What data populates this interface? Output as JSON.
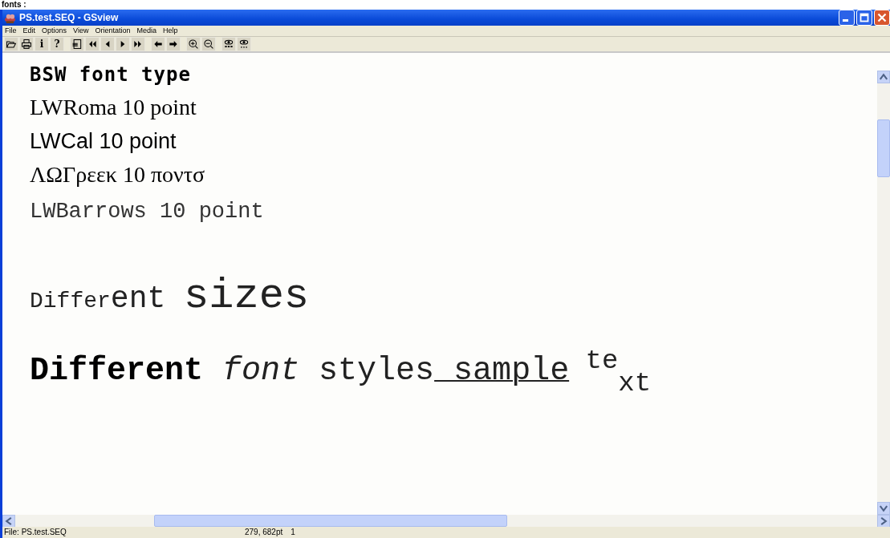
{
  "caption": "fonts :",
  "window": {
    "title": "PS.test.SEQ - GSview"
  },
  "menu": [
    "File",
    "Edit",
    "Options",
    "View",
    "Orientation",
    "Media",
    "Help"
  ],
  "toolbar": [
    [
      {
        "kind": "open"
      },
      {
        "kind": "print"
      },
      {
        "kind": "text",
        "label": "i"
      },
      {
        "kind": "text",
        "label": "?"
      }
    ],
    [
      {
        "kind": "page"
      },
      {
        "kind": "first"
      },
      {
        "kind": "prev"
      },
      {
        "kind": "next"
      },
      {
        "kind": "last"
      }
    ],
    [
      {
        "kind": "back"
      },
      {
        "kind": "forward"
      }
    ],
    [
      {
        "kind": "zoomin"
      },
      {
        "kind": "zoomout"
      }
    ],
    [
      {
        "kind": "eyeabc"
      },
      {
        "kind": "eyedots"
      }
    ]
  ],
  "document": {
    "lines": [
      {
        "kind": "pixel",
        "segments": [
          {
            "kind": "plain",
            "text": "BSW font type"
          }
        ]
      },
      {
        "kind": "serif",
        "segments": [
          {
            "kind": "plain",
            "text": "LWRoma 10 point"
          }
        ]
      },
      {
        "kind": "sans",
        "segments": [
          {
            "kind": "plain",
            "text": "LWCal 10 point"
          }
        ]
      },
      {
        "kind": "serif",
        "segments": [
          {
            "kind": "plain",
            "text": "ΛΩΓρεεκ 10 ποντσ"
          }
        ]
      },
      {
        "kind": "mono",
        "segments": [
          {
            "kind": "plain",
            "text": "LWBarrows 10 point"
          }
        ]
      },
      {
        "kind": "sizes",
        "segments": [
          {
            "kind": "small",
            "text": "Differ"
          },
          {
            "kind": "medium",
            "text": "ent "
          },
          {
            "kind": "large",
            "text": "sizes"
          }
        ]
      },
      {
        "kind": "styles",
        "segments": [
          {
            "kind": "bold",
            "text": "Different "
          },
          {
            "kind": "italic",
            "text": "font "
          },
          {
            "kind": "plain",
            "text": "styles"
          },
          {
            "kind": "underline",
            "text": " sample"
          },
          {
            "kind": "super",
            "text": "te"
          },
          {
            "kind": "sub",
            "text": "xt"
          }
        ]
      }
    ]
  },
  "status_bar": {
    "file": "File: PS.test.SEQ",
    "position": "279, 682pt",
    "page": "1"
  }
}
